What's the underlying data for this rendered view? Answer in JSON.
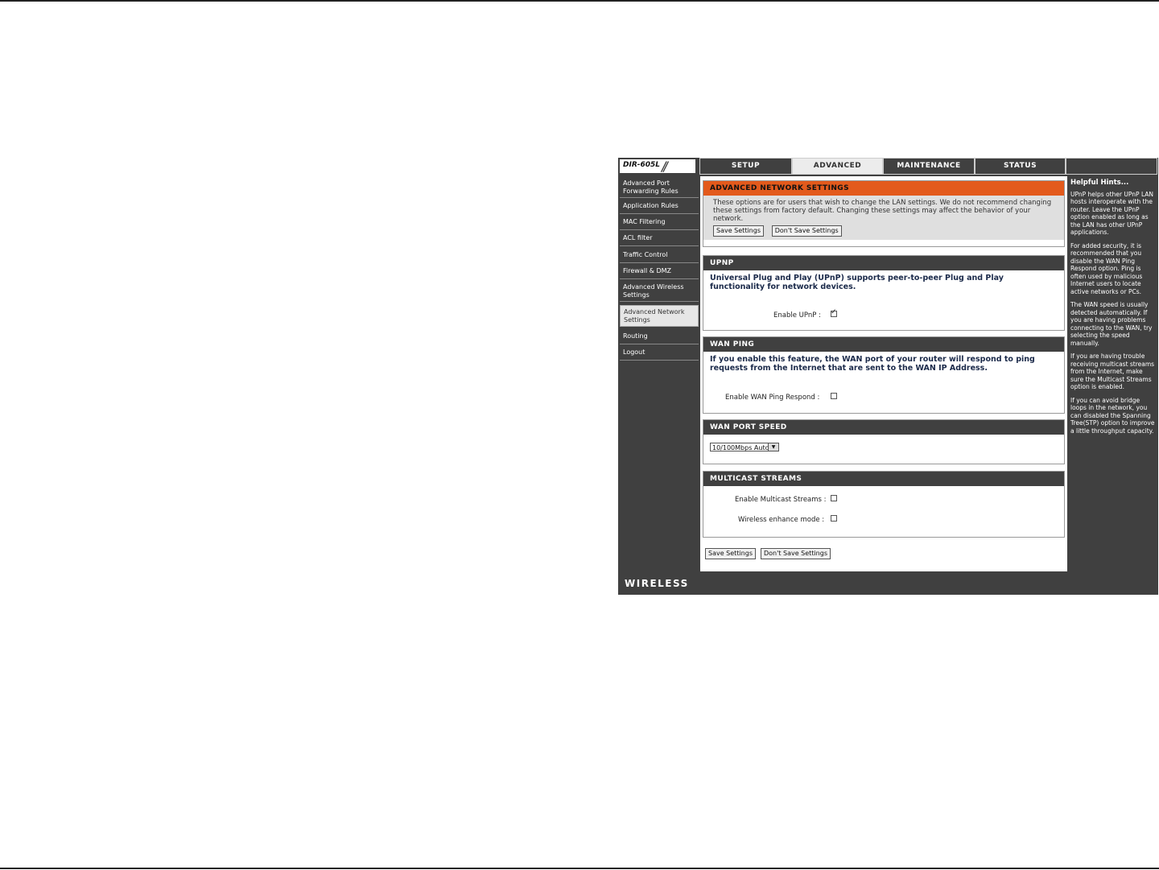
{
  "header": {
    "model": "DIR-605L",
    "tabs": [
      {
        "label": "SETUP"
      },
      {
        "label": "ADVANCED"
      },
      {
        "label": "MAINTENANCE"
      },
      {
        "label": "STATUS"
      }
    ],
    "active_tab": "ADVANCED"
  },
  "sidebar": {
    "items": [
      {
        "label": "Advanced Port Forwarding Rules"
      },
      {
        "label": "Application Rules"
      },
      {
        "label": "MAC Filtering"
      },
      {
        "label": "ACL filter"
      },
      {
        "label": "Traffic Control"
      },
      {
        "label": "Firewall & DMZ"
      },
      {
        "label": "Advanced Wireless Settings"
      },
      {
        "label": "Advanced Network Settings"
      },
      {
        "label": "Routing"
      },
      {
        "label": "Logout"
      }
    ],
    "active_item": "Advanced Network Settings"
  },
  "intro": {
    "title": "ADVANCED NETWORK SETTINGS",
    "text": "These options are for users that wish to change the LAN settings. We do not recommend changing these settings from factory default. Changing these settings may affect the behavior of your network.",
    "save_label": "Save Settings",
    "dont_save_label": "Don't Save Settings"
  },
  "upnp": {
    "title": "UPNP",
    "description": "Universal Plug and Play (UPnP) supports peer-to-peer Plug and Play functionality for network devices.",
    "enable_label": "Enable UPnP  :",
    "enabled": true
  },
  "wan_ping": {
    "title": "WAN PING",
    "description": "If you enable this feature, the WAN port of your router will respond to ping requests from the Internet that are sent to the WAN IP Address.",
    "enable_label": "Enable WAN Ping Respond  :",
    "enabled": false
  },
  "wan_port_speed": {
    "title": "WAN PORT SPEED",
    "selected": "10/100Mbps Auto"
  },
  "multicast": {
    "title": "MULTICAST STREAMS",
    "enable_label": "Enable Multicast Streams :",
    "enable_checked": false,
    "wireless_label": "Wireless enhance mode :",
    "wireless_checked": false
  },
  "bottom_buttons": {
    "save_label": "Save Settings",
    "dont_save_label": "Don't Save Settings"
  },
  "hints": {
    "title": "Helpful Hints...",
    "paragraphs": [
      "UPnP helps other UPnP LAN hosts interoperate with the router. Leave the UPnP option enabled as long as the LAN has other UPnP applications.",
      "For added security, it is recommended that you disable the WAN Ping Respond option. Ping is often used by malicious Internet users to locate active networks or PCs.",
      "The WAN speed is usually detected automatically. If you are having problems connecting to the WAN, try selecting the speed manually.",
      "If you are having trouble receiving multicast streams from the Internet, make sure the Multicast Streams option is enabled.",
      "If you can avoid bridge loops in the network, you can disabled the Spanning Tree(STP) option to improve a little throughput capacity."
    ]
  },
  "footer": {
    "brand": "WIRELESS"
  }
}
